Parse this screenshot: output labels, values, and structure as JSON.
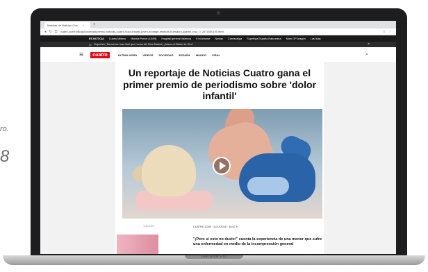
{
  "background_fragments": {
    "line1": "ro.",
    "line2": "8"
  },
  "device": {
    "label": "MacBook Pro"
  },
  "browser": {
    "tab_title": "Noticias de Noticias Cua...",
    "tab_close": "×",
    "new_tab": "+",
    "url": "cuatro.com/noticias/sociedad/premio-noticias-cuatro-dolor-infantil-joven-montaje-esteban-buesadro-gabriel-cruz_0_2671650190.html",
    "nav_icons": [
      "back-icon",
      "reload-icon",
      "lock-icon"
    ],
    "right_icons": [
      "star-icon",
      "menu-icon"
    ]
  },
  "newsbar": {
    "label": "ES NOTICIA",
    "items": [
      "Cuarto Milenio",
      "Mónica Ponce (15/09)",
      "Hospital general Valencia",
      "El síndrome",
      "Novias",
      "Carnavaliga",
      "Superliga España Naturaleza",
      "Moto GP Aragón",
      "Las Islas"
    ]
  },
  "alertbar": {
    "text": "Deportes | Benzema: mas fácil que nunca del Real Madrid, ¿Marca el Balón de Oro?",
    "close": "×"
  },
  "site": {
    "logo": "cuatro",
    "nav": [
      "ÚLTIMA HORA",
      "VÍDEOS",
      "SOCIEDAD",
      "ESPAÑA",
      "MUNDO",
      "VIRAL"
    ]
  },
  "article": {
    "headline": "Un reportaje de Noticias Cuatro gana el primer premio de periodismo sobre 'dolor infantil'",
    "photo_caption": "Telecuatro",
    "byline": "CUATRO.COM  ·  11/12/2018  ·  16:42 h",
    "lead": "\"¡Pero si esto no duele!\" cuenta la experiencia de una menor que sufre una enfermedad en medio de la incomprensión general"
  }
}
